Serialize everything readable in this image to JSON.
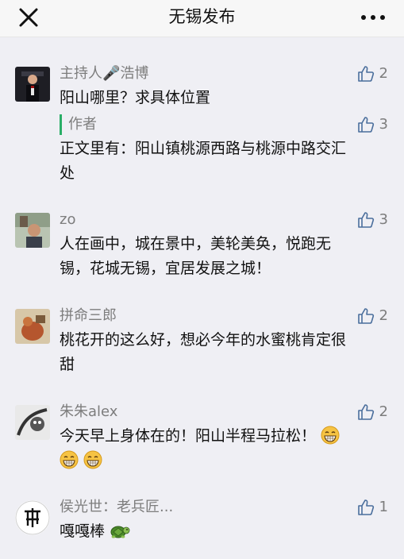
{
  "header": {
    "title": "无锡发布"
  },
  "comments": [
    {
      "name": "主持人🎤浩博",
      "likes": "2",
      "text": "阳山哪里？求具体位置",
      "reply": {
        "label": "作者",
        "likes": "3",
        "text_line1": "正文里有：阳山镇桃源西路与桃源中路交汇",
        "text_line2": "处"
      }
    },
    {
      "name": "zo",
      "likes": "3",
      "text_line1": "人在画中，城在景中，美轮美奂，悦跑无",
      "text_line2": "锡，花城无锡，宜居发展之城！"
    },
    {
      "name": "拼命三郎",
      "likes": "2",
      "text_line1": "桃花开的这么好，想必今年的水蜜桃肯定很",
      "text_line2": "甜"
    },
    {
      "name": "朱朱alex",
      "likes": "2",
      "text_line1": "今天早上身体在的！阳山半程马拉松！"
    },
    {
      "name": "侯光世：老兵匠...",
      "likes": "1",
      "text_line1": "嘎嘎棒"
    }
  ],
  "icons": {
    "close": "close-icon",
    "more": "more-icon",
    "like": "thumbs-up-icon",
    "grin": "grinning-emoji",
    "turtle": "turtle-emoji"
  },
  "colors": {
    "accent": "#2aae67",
    "icon": "#4a6e9c"
  }
}
